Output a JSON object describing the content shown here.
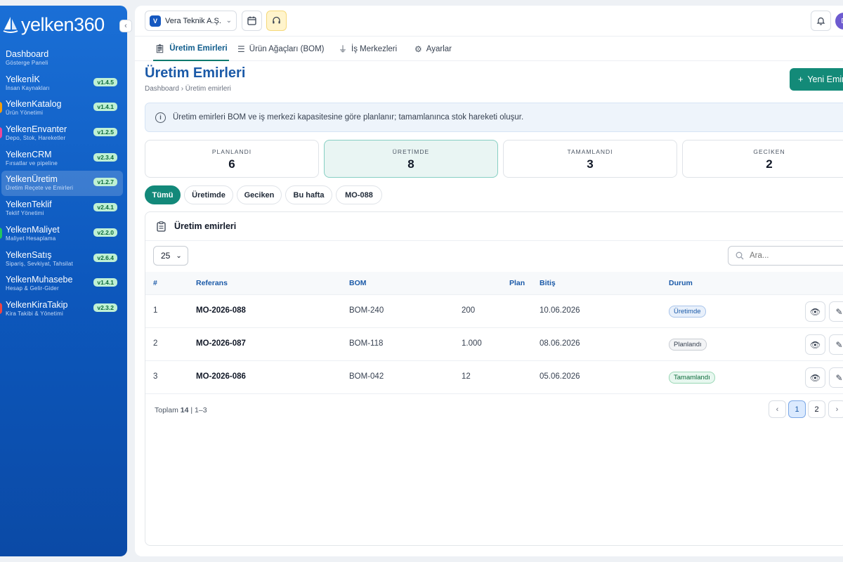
{
  "sidebar": {
    "brand": "yelken360",
    "items": [
      {
        "label": "Dashboard",
        "sub": "Gösterge Paneli",
        "version": ""
      },
      {
        "label": "YelkenİK",
        "sub": "İnsan Kaynakları",
        "version": "v1.4.5"
      },
      {
        "label": "YelkenKatalog",
        "sub": "Ürün Yönetimi",
        "version": "v1.4.1"
      },
      {
        "label": "YelkenEnvanter",
        "sub": "Depo, Stok, Hareketler",
        "version": "v1.2.5"
      },
      {
        "label": "YelkenCRM",
        "sub": "Fırsatlar ve pipeline",
        "version": "v2.3.4"
      },
      {
        "label": "YelkenÜretim",
        "sub": "Üretim Reçete ve Emirleri",
        "version": "v1.2.7"
      },
      {
        "label": "YelkenTeklif",
        "sub": "Teklif Yönetimi",
        "version": "v2.4.1"
      },
      {
        "label": "YelkenMaliyet",
        "sub": "Maliyet Hesaplama",
        "version": "v2.2.0"
      },
      {
        "label": "YelkenSatış",
        "sub": "Sipariş, Sevkiyat, Tahsilat",
        "version": "v2.6.4"
      },
      {
        "label": "YelkenMuhasebe",
        "sub": "Hesap & Gelir-Gider",
        "version": "v1.4.1"
      },
      {
        "label": "YelkenKiraTakip",
        "sub": "Kira Takibi & Yönetimi",
        "version": "v2.3.2"
      }
    ]
  },
  "topbar": {
    "company_initial": "V",
    "company": "Vera Teknik A.Ş.",
    "avatar_initial": "D"
  },
  "tabs": [
    {
      "label": "Üretim Emirleri"
    },
    {
      "label": "Ürün Ağaçları (BOM)"
    },
    {
      "label": "İş Merkezleri"
    },
    {
      "label": "Ayarlar"
    }
  ],
  "page": {
    "title": "Üretim Emirleri",
    "breadcrumb": "Dashboard › Üretim emirleri",
    "new_button": "Yeni Emir",
    "info": "Üretim emirleri BOM ve iş merkezi kapasitesine göre planlanır; tamamlanınca stok hareketi oluşur."
  },
  "stats": [
    {
      "label": "PLANLANDI",
      "value": "6"
    },
    {
      "label": "ÜRETİMDE",
      "value": "8"
    },
    {
      "label": "TAMAMLANDI",
      "value": "3"
    },
    {
      "label": "GECİKEN",
      "value": "2"
    }
  ],
  "filters": [
    "Tümü",
    "Üretimde",
    "Geciken",
    "Bu hafta",
    "MO-088"
  ],
  "table": {
    "title": "Üretim emirleri",
    "page_size": "25",
    "search_placeholder": "Ara...",
    "headers": [
      "#",
      "Referans",
      "BOM",
      "Plan",
      "Bitiş",
      "Durum"
    ],
    "rows": [
      {
        "no": "1",
        "ref": "MO-2026-088",
        "bom": "BOM-240",
        "plan": "200",
        "end": "10.06.2026",
        "status": "Üretimde"
      },
      {
        "no": "2",
        "ref": "MO-2026-087",
        "bom": "BOM-118",
        "plan": "1.000",
        "end": "08.06.2026",
        "status": "Planlandı"
      },
      {
        "no": "3",
        "ref": "MO-2026-086",
        "bom": "BOM-042",
        "plan": "12",
        "end": "05.06.2026",
        "status": "Tamamlandı"
      }
    ],
    "total_prefix": "Toplam",
    "total": "14",
    "range": "| 1–3",
    "pages": [
      "1",
      "2"
    ]
  }
}
